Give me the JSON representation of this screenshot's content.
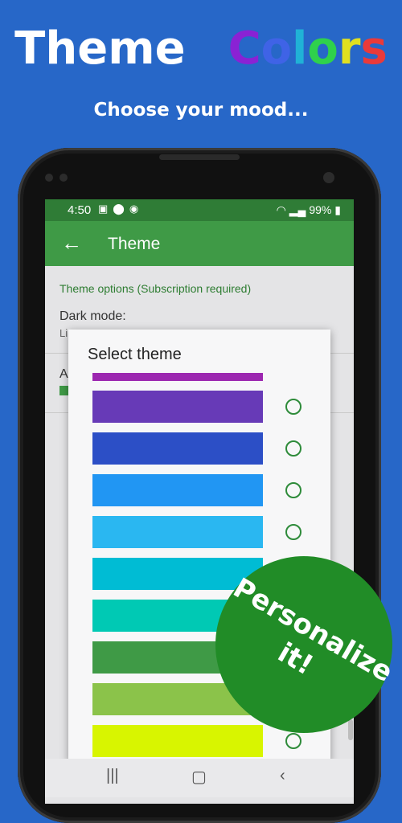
{
  "headline": {
    "word1": "Theme",
    "letters": [
      {
        "char": "C",
        "color": "#8a22d4"
      },
      {
        "char": "o",
        "color": "#3f63e6"
      },
      {
        "char": "l",
        "color": "#20b2d6"
      },
      {
        "char": "o",
        "color": "#2fd14c"
      },
      {
        "char": "r",
        "color": "#e0e020"
      },
      {
        "char": "s",
        "color": "#ea3a3a"
      }
    ]
  },
  "subline": "Choose your mood...",
  "status_bar": {
    "time": "4:50",
    "battery": "99%"
  },
  "app_bar": {
    "back_icon": "arrow-left-icon",
    "title": "Theme"
  },
  "settings": {
    "section_header": "Theme options (Subscription required)",
    "dark_mode_label": "Dark mode:",
    "dark_mode_value": "Li",
    "accent_label": "A"
  },
  "dialog": {
    "title": "Select theme",
    "themes": [
      {
        "color": "#9c27b0"
      },
      {
        "color": "#673ab7"
      },
      {
        "color": "#2c4fc6"
      },
      {
        "color": "#2196f3"
      },
      {
        "color": "#2ab7f1"
      },
      {
        "color": "#00bcd4"
      },
      {
        "color": "#00c9b4"
      },
      {
        "color": "#3f9a46"
      },
      {
        "color": "#8bc34a"
      },
      {
        "color": "#d8f500"
      }
    ]
  },
  "badge": {
    "line1": "Personalize",
    "line2": "it!"
  },
  "colors": {
    "background": "#2767c8",
    "app_green": "#3f9a46",
    "badge_green": "#218c27"
  }
}
